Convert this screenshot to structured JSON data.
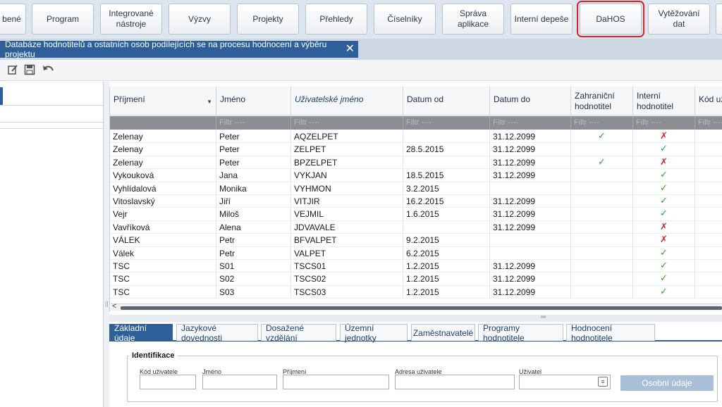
{
  "nav": {
    "items": [
      {
        "label": "bené"
      },
      {
        "label": "Program"
      },
      {
        "label": "Integrované nástroje"
      },
      {
        "label": "Výzvy"
      },
      {
        "label": "Projekty"
      },
      {
        "label": "Přehledy"
      },
      {
        "label": "Číselníky"
      },
      {
        "label": "Správa aplikace"
      },
      {
        "label": "Interní depeše"
      },
      {
        "label": "DaHOS"
      },
      {
        "label": "Vytěžování dat"
      }
    ],
    "active": "DaHOS",
    "highlight_color": "#d9232a"
  },
  "window": {
    "title": "Databáze hodnotitelů a ostatních osob podílejících se na procesu hodnocení a výběru projektu",
    "close_glyph": "✕"
  },
  "toolbar": {
    "icons": [
      "edit-icon",
      "save-icon",
      "undo-icon"
    ]
  },
  "grid": {
    "columns": [
      {
        "label": "Příjmení"
      },
      {
        "label": "Jméno"
      },
      {
        "label": "Uživatelské jméno"
      },
      {
        "label": "Datum od"
      },
      {
        "label": "Datum do"
      },
      {
        "label": "Zahraniční hodnotitel"
      },
      {
        "label": "Interní hodnotitel"
      },
      {
        "label": "Kód už"
      }
    ],
    "filter_placeholder": "Filtr ----",
    "rows": [
      {
        "prijmeni": "Zelenay",
        "jmeno": "Peter",
        "uzivatel": "AQZELPET",
        "od": "",
        "do": "31.12.2099",
        "zahranicni": "yes",
        "interni": "no"
      },
      {
        "prijmeni": "Zelenay",
        "jmeno": "Peter",
        "uzivatel": "ZELPET",
        "od": "28.5.2015",
        "do": "31.12.2099",
        "zahranicni": "",
        "interni": "yes"
      },
      {
        "prijmeni": "Zelenay",
        "jmeno": "Peter",
        "uzivatel": "BPZELPET",
        "od": "",
        "do": "31.12.2099",
        "zahranicni": "yes",
        "interni": "no"
      },
      {
        "prijmeni": "Vykouková",
        "jmeno": "Jana",
        "uzivatel": "VYKJAN",
        "od": "18.5.2015",
        "do": "31.12.2099",
        "zahranicni": "",
        "interni": "yes"
      },
      {
        "prijmeni": "Vyhlídalová",
        "jmeno": "Monika",
        "uzivatel": "VYHMON",
        "od": "3.2.2015",
        "do": "",
        "zahranicni": "",
        "interni": "yes"
      },
      {
        "prijmeni": "Vitoslavský",
        "jmeno": "Jiří",
        "uzivatel": "VITJIR",
        "od": "16.2.2015",
        "do": "31.12.2099",
        "zahranicni": "",
        "interni": "yes"
      },
      {
        "prijmeni": "Vejr",
        "jmeno": "Miloš",
        "uzivatel": "VEJMIL",
        "od": "1.6.2015",
        "do": "31.12.2099",
        "zahranicni": "",
        "interni": "yes"
      },
      {
        "prijmeni": "Vavříková",
        "jmeno": "Alena",
        "uzivatel": "JDVAVALE",
        "od": "",
        "do": "31.12.2099",
        "zahranicni": "",
        "interni": "no"
      },
      {
        "prijmeni": "VÁLEK",
        "jmeno": "Petr",
        "uzivatel": "BFVALPET",
        "od": "9.2.2015",
        "do": "",
        "zahranicni": "",
        "interni": "no"
      },
      {
        "prijmeni": "Válek",
        "jmeno": "Petr",
        "uzivatel": "VALPET",
        "od": "6.2.2015",
        "do": "",
        "zahranicni": "",
        "interni": "yes"
      },
      {
        "prijmeni": "TSC",
        "jmeno": "S01",
        "uzivatel": "TSCS01",
        "od": "1.2.2015",
        "do": "31.12.2099",
        "zahranicni": "",
        "interni": "yes"
      },
      {
        "prijmeni": "TSC",
        "jmeno": "S02",
        "uzivatel": "TSCS02",
        "od": "1.2.2015",
        "do": "31.12.2099",
        "zahranicni": "",
        "interni": "yes"
      },
      {
        "prijmeni": "TSC",
        "jmeno": "S03",
        "uzivatel": "TSCS03",
        "od": "1.2.2015",
        "do": "31.12.2099",
        "zahranicni": "",
        "interni": "yes"
      }
    ],
    "check_color": "#2ea12e",
    "cross_color": "#d0262b"
  },
  "detail": {
    "tabs": [
      {
        "label": "Základní údaje"
      },
      {
        "label": "Jazykové dovednosti"
      },
      {
        "label": "Dosažené vzdělání"
      },
      {
        "label": "Územní jednotky"
      },
      {
        "label": "Zaměstnavatelé"
      },
      {
        "label": "Programy hodnotitele"
      },
      {
        "label": "Hodnocení hodnotitele"
      }
    ],
    "active_tab": "Základní údaje",
    "fieldset_title": "Identifikace",
    "fields": [
      {
        "label": "Kód uživatele",
        "value": ""
      },
      {
        "label": "Jméno",
        "value": ""
      },
      {
        "label": "Příjmení",
        "value": ""
      },
      {
        "label": "Adresa uživatele",
        "value": ""
      },
      {
        "label": "Uživatel",
        "value": ""
      }
    ],
    "personal_button": "Osobní údaje"
  }
}
